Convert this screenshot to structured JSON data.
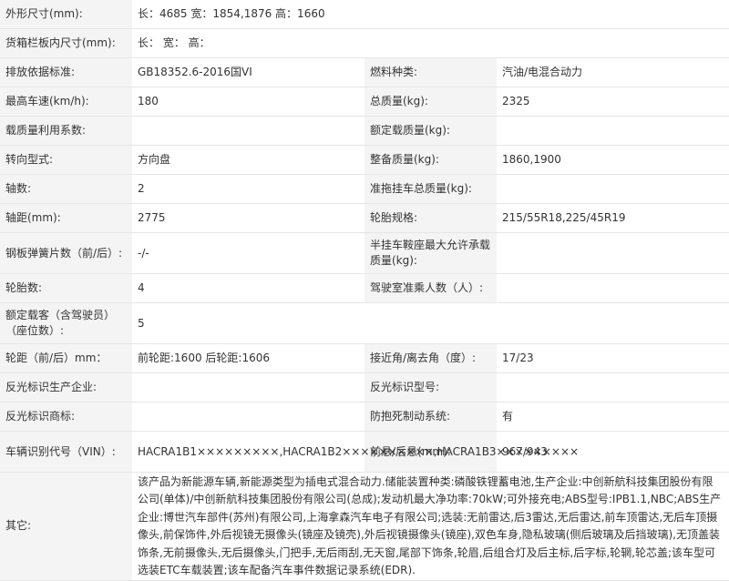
{
  "rows": [
    {
      "l1": "外形尺寸(mm):",
      "v1": "长：4685 宽：1854,1876 高：1660"
    },
    {
      "l1": "货箱栏板内尺寸(mm):",
      "v1": "长： 宽： 高："
    },
    {
      "l1": "排放依据标准:",
      "v1": "GB18352.6-2016国VI",
      "l2": "燃料种类:",
      "v2": "汽油/电混合动力"
    },
    {
      "l1": "最高车速(km/h):",
      "v1": "180",
      "l2": "总质量(kg):",
      "v2": "2325"
    },
    {
      "l1": "载质量利用系数:",
      "v1": "",
      "l2": "额定载质量(kg):",
      "v2": ""
    },
    {
      "l1": "转向型式:",
      "v1": "方向盘",
      "l2": "整备质量(kg):",
      "v2": "1860,1900"
    },
    {
      "l1": "轴数:",
      "v1": "2",
      "l2": "准拖挂车总质量(kg):",
      "v2": ""
    },
    {
      "l1": "轴距(mm):",
      "v1": "2775",
      "l2": "轮胎规格:",
      "v2": "215/55R18,225/45R19"
    },
    {
      "l1": "钢板弹簧片数（前/后）:",
      "v1": "-/-",
      "l2": "半挂车鞍座最大允许承载质量(kg):",
      "v2": ""
    },
    {
      "l1": "轮胎数:",
      "v1": "4",
      "l2": "驾驶室准乘人数（人）:",
      "v2": ""
    },
    {
      "l1": "额定载客（含驾驶员）（座位数）:",
      "v1": "5"
    },
    {
      "l1": "轮距（前/后）mm：",
      "v1": "前轮距:1600 后轮距:1606",
      "l2": "接近角/离去角（度）:",
      "v2": "17/23"
    },
    {
      "l1": "反光标识生产企业:",
      "v1": "",
      "l2": "反光标识型号:",
      "v2": ""
    },
    {
      "l1": "反光标识商标:",
      "v1": "",
      "l2": "防抱死制动系统:",
      "v2": "有"
    },
    {
      "l1": "车辆识别代号（VIN）:",
      "v1": "HACRA1B1×××××××××,HACRA1B2××××××××××,HACRA1B3×××××××××",
      "l2": "前悬/后悬(mm):",
      "v2": "967/943"
    }
  ],
  "other": {
    "label": "其它:",
    "text": "该产品为新能源车辆,新能源类型为插电式混合动力.储能装置种类:磷酸铁锂蓄电池,生产企业:中创新航科技集团股份有限公司(单体)/中创新航科技集团股份有限公司(总成);发动机最大净功率:70kW;可外接充电;ABS型号:IPB1.1,NBC;ABS生产企业:博世汽车部件(苏州)有限公司,上海拿森汽车电子有限公司;选装:无前雷达,后3雷达,无后雷达,前车顶雷达,无后车顶摄像头,前保饰件,外后视镜无摄像头(镜座及镜壳),外后视镜摄像头(镜座),双色车身,隐私玻璃(侧后玻璃及后挡玻璃),无顶盖装饰条,无前摄像头,无后摄像头,门把手,无后雨刮,无天窗,尾部下饰条,轮眉,后组合灯及后主标,后字标,轮辋,轮芯盖;该车型可选装ETC车载装置;该车配备汽车事件数据记录系统(EDR)."
  }
}
